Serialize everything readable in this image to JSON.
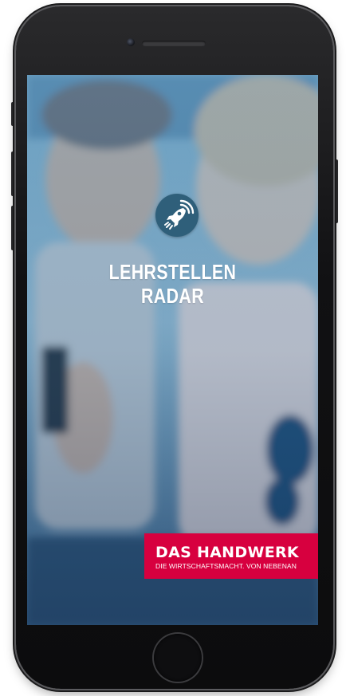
{
  "app": {
    "title_line1": "LEHRSTELLEN",
    "title_line2": "RADAR",
    "icon": "rocket-radar-icon"
  },
  "brand": {
    "name": "DAS HANDWERK",
    "tagline": "DIE WIRTSCHAFTSMACHT. VON NEBENAN",
    "color": "#d7003f"
  },
  "colors": {
    "overlay": "#4a86b2",
    "icon_background": "#2f5f7a"
  }
}
